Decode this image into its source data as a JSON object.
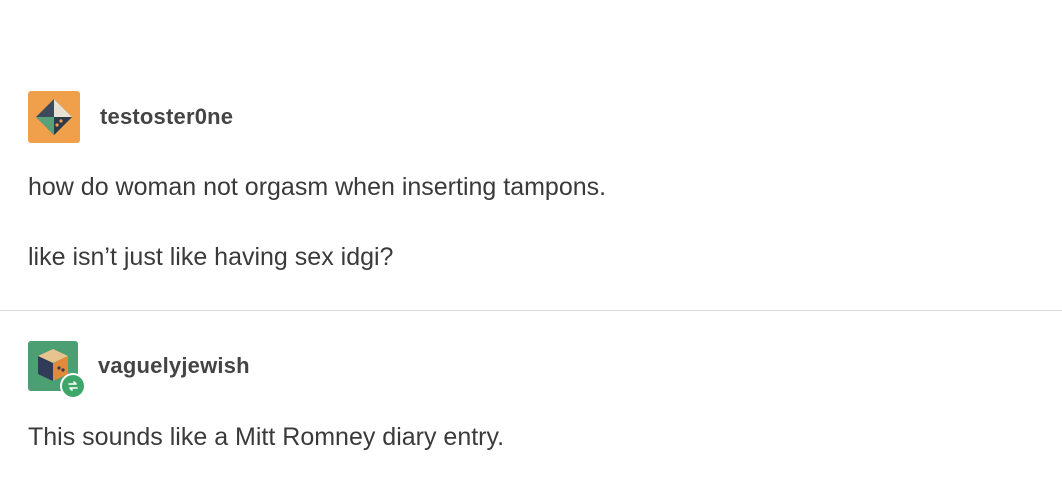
{
  "posts": [
    {
      "username": "testoster0ne",
      "avatar_icon": "geometric-diamond-icon",
      "avatar_color": "#f0a04b",
      "lines": [
        "how do woman not orgasm when inserting tampons.",
        "like isn’t just like having sex idgi?"
      ]
    },
    {
      "username": "vaguelyjewish",
      "avatar_icon": "cube-icon",
      "avatar_color": "#4c9e73",
      "badge_icon": "reblog-icon",
      "lines": [
        "This sounds like a Mitt Romney diary entry."
      ]
    }
  ]
}
